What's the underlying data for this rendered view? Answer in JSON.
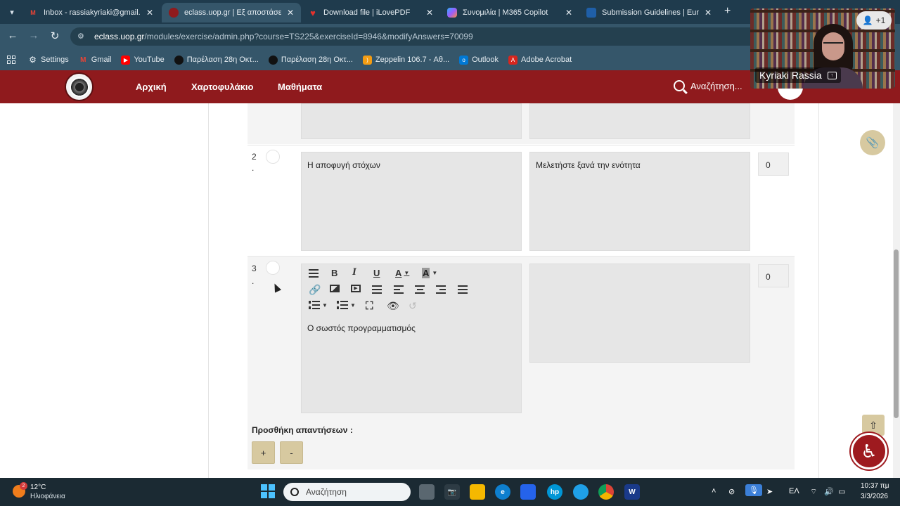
{
  "browser": {
    "tabs": [
      {
        "title": "Inbox - rassiakyriaki@gmail.com",
        "icon": "gmail-icon",
        "color": "#d93025"
      },
      {
        "title": "eclass.uop.gr | Εξ αποστάσεως",
        "icon": "eclass-icon",
        "color": "#8f1a1d"
      },
      {
        "title": "Download file | iLovePDF",
        "icon": "ilovepdf-icon",
        "color": "#e5322d"
      },
      {
        "title": "Συνομιλία | M365 Copilot",
        "icon": "copilot-icon",
        "color": "#7b61ff"
      },
      {
        "title": "Submission Guidelines | Europe",
        "icon": "europe-icon",
        "color": "#1f5fa8"
      }
    ],
    "url_domain": "eclass.uop.gr",
    "url_rest": "/modules/exercise/admin.php?course=TS225&exerciseId=8946&modifyAnswers=70099",
    "bookmarks": [
      {
        "label": "Settings",
        "icon": "gear-icon",
        "color": "#5f6368"
      },
      {
        "label": "Gmail",
        "icon": "gmail-icon",
        "color": "#d93025"
      },
      {
        "label": "YouTube",
        "icon": "youtube-icon",
        "color": "#ff0000"
      },
      {
        "label": "Παρέλαση 28η Οκτ...",
        "icon": "video-icon",
        "color": "#222222"
      },
      {
        "label": "Παρέλαση 28η Οκτ...",
        "icon": "video-icon",
        "color": "#222222"
      },
      {
        "label": "Zeppelin 106.7 - Αθ...",
        "icon": "rss-icon",
        "color": "#f39c12"
      },
      {
        "label": "Outlook",
        "icon": "outlook-icon",
        "color": "#0078d4"
      },
      {
        "label": "Adobe Acrobat",
        "icon": "acrobat-icon",
        "color": "#d7261e"
      }
    ]
  },
  "site": {
    "nav": [
      "Αρχική",
      "Χαρτοφυλάκιο",
      "Μαθήματα"
    ],
    "search_label": "Αναζήτηση..."
  },
  "answers": [
    {
      "num": "2",
      "dot": ".",
      "answer": "Η αποφυγή στόχων",
      "comment": "Μελετήστε ξανά την ενότητα",
      "weight": "0"
    },
    {
      "num": "3",
      "dot": ".",
      "answer": "Ο σωστός προγραμματισμός",
      "comment": "",
      "weight": "0"
    }
  ],
  "add_answers_label": "Προσθήκη απαντήσεων :",
  "add_buttons": [
    "+",
    "-"
  ],
  "video": {
    "name": "Kyriaki Rassia",
    "participants": "+1"
  },
  "taskbar": {
    "temperature": "12°C",
    "weather": "Ηλιοφάνεια",
    "weather_badge": "2",
    "search_placeholder": "Αναζήτηση",
    "language": "ΕΛ",
    "time": "10:37 πμ",
    "date": "3/3/2026"
  }
}
